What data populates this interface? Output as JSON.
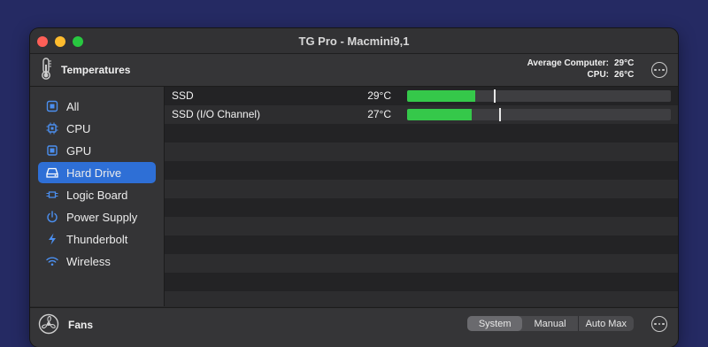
{
  "window": {
    "title": "TG Pro - Macmini9,1"
  },
  "toolbar": {
    "title": "Temperatures",
    "summary": [
      {
        "label": "Average Computer:",
        "value": "29°C"
      },
      {
        "label": "CPU:",
        "value": "26°C"
      }
    ]
  },
  "sidebar": {
    "items": [
      {
        "label": "All",
        "icon": "all-icon"
      },
      {
        "label": "CPU",
        "icon": "cpu-chip-icon"
      },
      {
        "label": "GPU",
        "icon": "gpu-chip-icon"
      },
      {
        "label": "Hard Drive",
        "icon": "hard-drive-icon",
        "selected": true
      },
      {
        "label": "Logic Board",
        "icon": "logic-board-icon"
      },
      {
        "label": "Power Supply",
        "icon": "power-icon"
      },
      {
        "label": "Thunderbolt",
        "icon": "thunderbolt-icon"
      },
      {
        "label": "Wireless",
        "icon": "wifi-icon"
      }
    ]
  },
  "sensors": [
    {
      "name": "SSD",
      "temp": "29°C",
      "level": 0.26,
      "marker": 0.33
    },
    {
      "name": "SSD (I/O Channel)",
      "temp": "27°C",
      "level": 0.245,
      "marker": 0.35
    }
  ],
  "fans": {
    "title": "Fans",
    "modes": [
      "System",
      "Manual",
      "Auto Max"
    ],
    "active_mode": "System"
  },
  "colors": {
    "accent": "#2e6fd6",
    "bar_fill": "#35c84a",
    "background": "#252a63"
  }
}
